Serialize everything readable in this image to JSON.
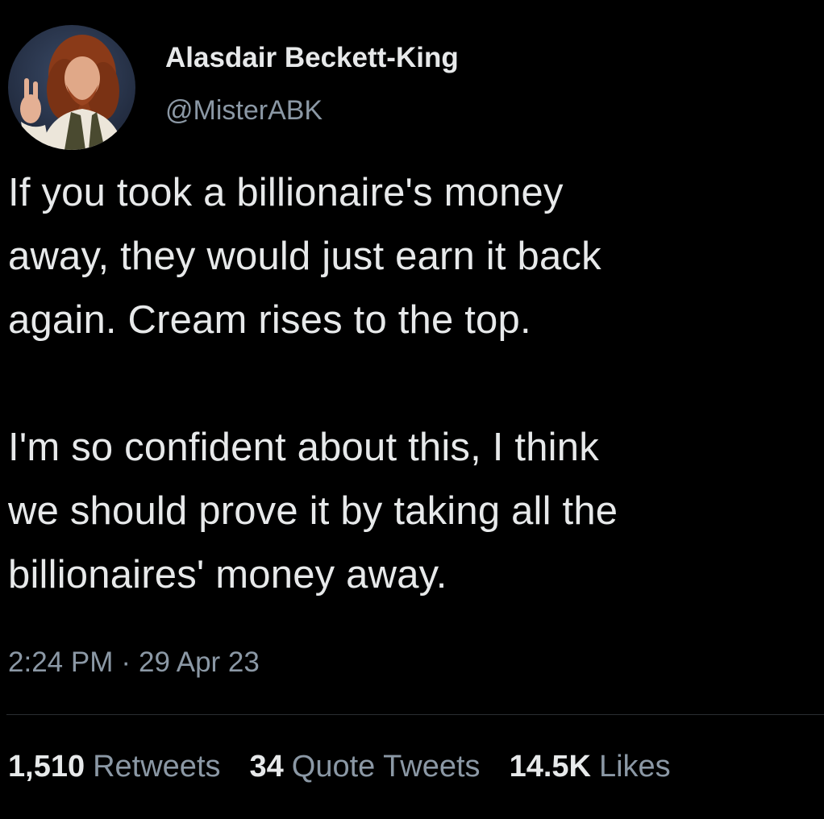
{
  "user": {
    "display_name": "Alasdair Beckett-King",
    "handle": "@MisterABK"
  },
  "tweet": {
    "text": "If you took a billionaire's money\naway, they would just earn it back\nagain. Cream rises to the top.\n\nI'm so confident about this, I think\nwe should prove it by taking all the\nbillionaires' money away.",
    "time": "2:24 PM",
    "separator": "·",
    "date": "29 Apr 23"
  },
  "stats": {
    "retweets": {
      "count": "1,510",
      "label": "Retweets"
    },
    "quotes": {
      "count": "34",
      "label": "Quote Tweets"
    },
    "likes": {
      "count": "14.5K",
      "label": "Likes"
    }
  },
  "colors": {
    "background": "#000000",
    "primary_text": "#e7e9ea",
    "secondary_text": "#8b98a5",
    "divider": "#2a2d31"
  }
}
